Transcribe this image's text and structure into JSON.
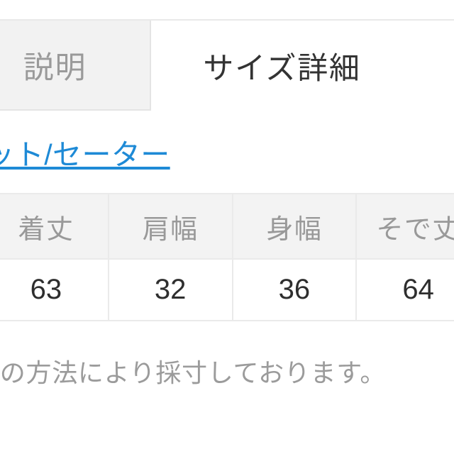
{
  "page": {
    "background_color": "#ffffff"
  },
  "tabs": {
    "items": [
      {
        "label": "説明",
        "state": "inactive"
      },
      {
        "label": "サイズ詳細",
        "state": "active"
      }
    ],
    "inactive_color": "#9a9a9a",
    "active_color": "#333333",
    "inactive_background": "#f2f2f2"
  },
  "category": {
    "link_label": "ニット/セーター",
    "link_color": "#1e8ad6"
  },
  "size_table": {
    "headers": [
      "着丈",
      "肩幅",
      "身幅",
      "そで丈"
    ],
    "rows": [
      [
        "63",
        "32",
        "36",
        "64"
      ]
    ],
    "header_background": "#f3f3f3",
    "header_text_color": "#999999",
    "cell_text_color": "#2e2e2e",
    "border_color": "#eaeaea"
  },
  "note": {
    "text": "※当店独自の方法により採寸しております。",
    "color": "#9b9b9b"
  }
}
